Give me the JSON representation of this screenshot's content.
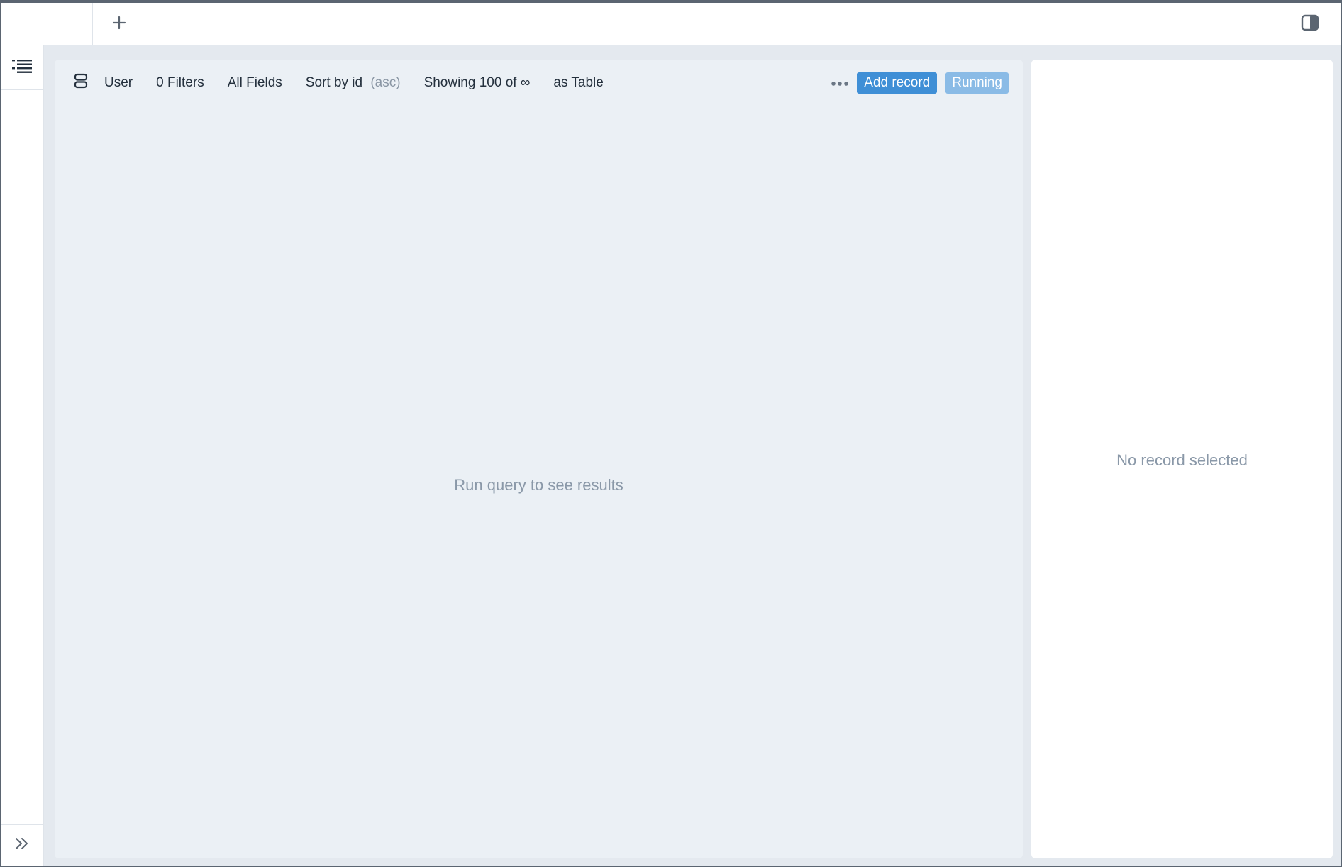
{
  "topbar": {
    "add_tab_icon": "plus-icon",
    "panel_toggle_icon": "sidebar-toggle-icon"
  },
  "rail": {
    "list_icon": "list-icon",
    "expand_icon": "chevron-double-right-icon"
  },
  "toolbar": {
    "model_icon": "database-icon",
    "model": "User",
    "filters": "0 Filters",
    "fields": "All Fields",
    "sort_label": "Sort by id",
    "sort_dir": "(asc)",
    "showing": "Showing 100 of ∞",
    "view_mode": "as Table",
    "more_icon": "more-horizontal-icon",
    "add_record": "Add record",
    "run_status": "Running"
  },
  "main": {
    "empty_message": "Run query to see results"
  },
  "detail": {
    "empty_message": "No record selected"
  },
  "colors": {
    "accent": "#3f8fd6",
    "accent_light": "#8abbe6",
    "panel_bg": "#ebf0f5",
    "muted_text": "#8a98a8"
  }
}
